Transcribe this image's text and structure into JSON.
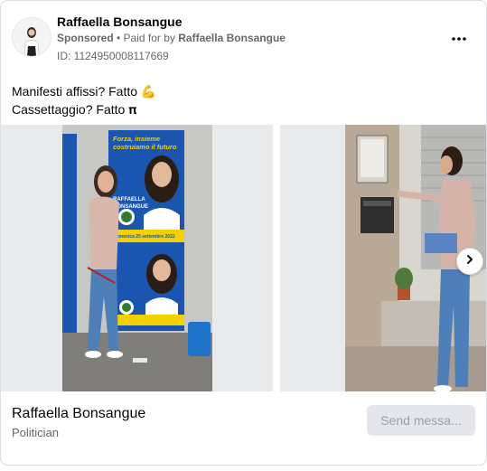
{
  "header": {
    "page_name": "Raffaella Bonsangue",
    "sponsored_label": "Sponsored",
    "separator": " • ",
    "paid_for_label": "Paid for by ",
    "paid_for_name": "Raffaella Bonsangue",
    "library_id": "ID: 1124950008117669"
  },
  "caption": {
    "line1": "Manifesti affissi? Fatto 💪",
    "line2": "Cassettaggio? Fatto 𝛑"
  },
  "carousel": {
    "next_icon": "chevron-right-icon",
    "slides": [
      {
        "poster_line1": "Forza, insieme",
        "poster_line2": "costruiamo il futuro",
        "poster_name1": "RAFFAELLA",
        "poster_name2": "BONSANGUE",
        "poster_date": "Domenica 25 settembre 2022"
      },
      {}
    ]
  },
  "footer": {
    "name": "Raffaella Bonsangue",
    "category": "Politician",
    "cta_label": "Send messa..."
  },
  "colors": {
    "text_primary": "#050505",
    "text_secondary": "#65676b",
    "cta_bg": "#e4e6eb",
    "poster_blue": "#1a56b0",
    "poster_yellow": "#f5d000"
  }
}
